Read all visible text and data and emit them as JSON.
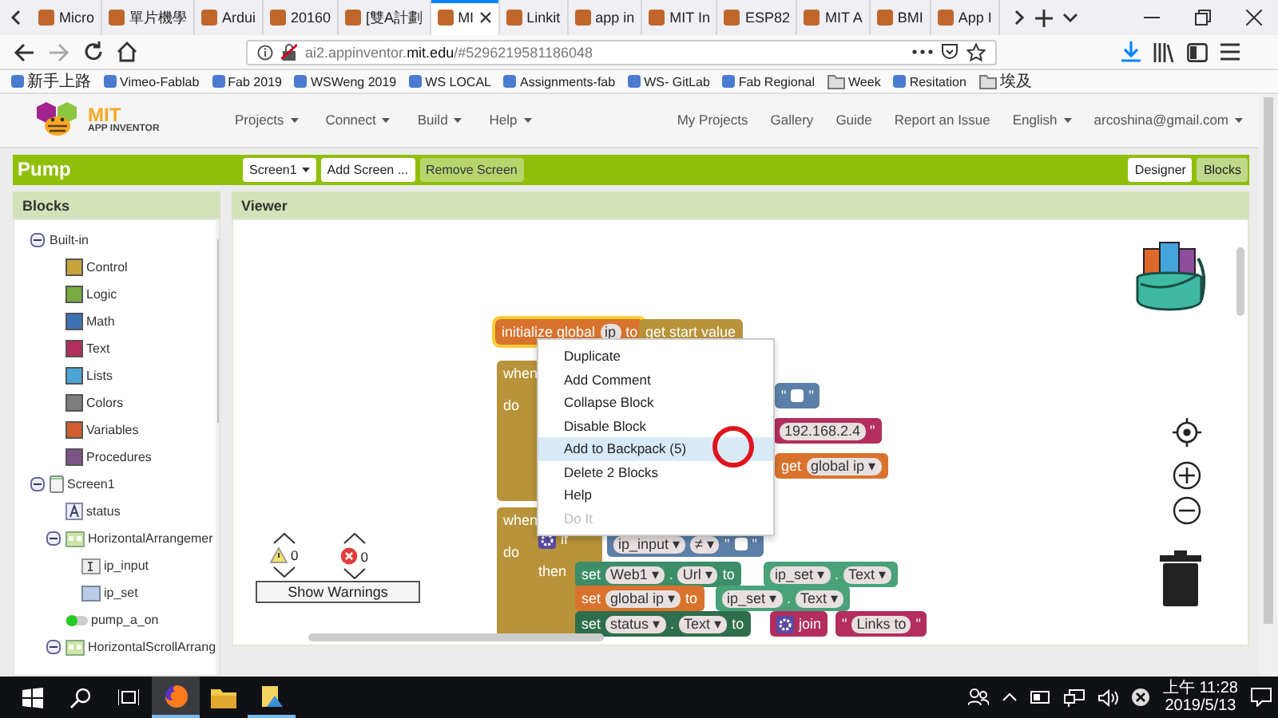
{
  "browser": {
    "tabs": [
      {
        "label": "Micro",
        "selected": false
      },
      {
        "label": "單片機學",
        "selected": false
      },
      {
        "label": "Ardui",
        "selected": false
      },
      {
        "label": "20160",
        "selected": false
      },
      {
        "label": "[雙A計劃",
        "selected": false
      },
      {
        "label": "MI",
        "selected": true
      },
      {
        "label": "Linkit",
        "selected": false
      },
      {
        "label": "app in",
        "selected": false
      },
      {
        "label": "MIT In",
        "selected": false
      },
      {
        "label": "ESP82",
        "selected": false
      },
      {
        "label": "MIT A",
        "selected": false
      },
      {
        "label": "BMI",
        "selected": false
      },
      {
        "label": "App I",
        "selected": false
      }
    ],
    "url": "ai2.appinventor.**mit.edu**/#5296219581186048",
    "bookmarks": [
      {
        "label": "新手上路",
        "kind": "site"
      },
      {
        "label": "Vimeo-Fablab",
        "kind": "site"
      },
      {
        "label": "Fab 2019",
        "kind": "site"
      },
      {
        "label": "WSWeng 2019",
        "kind": "site"
      },
      {
        "label": "WS LOCAL",
        "kind": "site"
      },
      {
        "label": "Assignments-fab",
        "kind": "site"
      },
      {
        "label": "WS- GitLab",
        "kind": "site"
      },
      {
        "label": "Fab Regional",
        "kind": "site"
      },
      {
        "label": "Week",
        "kind": "folder"
      },
      {
        "label": "Resitation",
        "kind": "site"
      },
      {
        "label": "埃及",
        "kind": "folder"
      }
    ]
  },
  "app": {
    "logo": {
      "title": "MIT",
      "subtitle": "APP INVENTOR"
    },
    "menus": [
      {
        "label": "Projects",
        "dropdown": true
      },
      {
        "label": "Connect",
        "dropdown": true
      },
      {
        "label": "Build",
        "dropdown": true
      },
      {
        "label": "Help",
        "dropdown": true
      }
    ],
    "links": [
      {
        "label": "My Projects",
        "dropdown": false
      },
      {
        "label": "Gallery",
        "dropdown": false
      },
      {
        "label": "Guide",
        "dropdown": false
      },
      {
        "label": "Report an Issue",
        "dropdown": false
      },
      {
        "label": "English",
        "dropdown": true
      },
      {
        "label": "arcoshina@gmail.com",
        "dropdown": true
      }
    ]
  },
  "project": {
    "name": "Pump",
    "screen": "Screen1",
    "buttons": [
      {
        "label": "Add Screen ...",
        "disabled": false
      },
      {
        "label": "Remove Screen",
        "disabled": true
      }
    ],
    "views": [
      {
        "label": "Designer",
        "selected": false
      },
      {
        "label": "Blocks",
        "selected": true
      }
    ]
  },
  "blocks_panel": {
    "title": "Blocks",
    "tree": [
      {
        "label": "Built-in",
        "kind": "group",
        "expanded": true,
        "children": [
          {
            "label": "Control",
            "kind": "category",
            "color": "#c9a43c"
          },
          {
            "label": "Logic",
            "kind": "category",
            "color": "#77ab41"
          },
          {
            "label": "Math",
            "kind": "category",
            "color": "#3f71b5"
          },
          {
            "label": "Text",
            "kind": "category",
            "color": "#b32d5e"
          },
          {
            "label": "Lists",
            "kind": "category",
            "color": "#49a6d4"
          },
          {
            "label": "Colors",
            "kind": "category",
            "color": "#7d7d7d"
          },
          {
            "label": "Variables",
            "kind": "category",
            "color": "#d05f2d"
          },
          {
            "label": "Procedures",
            "kind": "category",
            "color": "#7c5385"
          }
        ]
      },
      {
        "label": "Screen1",
        "kind": "screen",
        "expanded": true,
        "children": [
          {
            "label": "status",
            "kind": "label"
          },
          {
            "label": "HorizontalArrangemer",
            "kind": "arrangement",
            "expanded": true,
            "children": [
              {
                "label": "ip_input",
                "kind": "textbox"
              },
              {
                "label": "ip_set",
                "kind": "button"
              }
            ]
          },
          {
            "label": "pump_a_on",
            "kind": "switch"
          },
          {
            "label": "HorizontalScrollArrang",
            "kind": "arrangement",
            "expanded": true
          }
        ]
      }
    ]
  },
  "viewer": {
    "title": "Viewer",
    "blocks": [
      {
        "color": "#d9722c",
        "selected": true,
        "rows": [
          [
            {
              "kind": "label",
              "text": "initialize global"
            },
            {
              "kind": "field",
              "text": "ip"
            },
            {
              "kind": "label",
              "text": "to"
            }
          ]
        ]
      },
      {
        "color": "#b8933a",
        "selected": false,
        "rows": [
          [
            {
              "kind": "label",
              "text": "get start value"
            }
          ]
        ]
      },
      {
        "color": "#b8933a",
        "selected": false,
        "rows": [
          [
            {
              "kind": "label",
              "text": "when"
            }
          ],
          [
            {
              "kind": "label",
              "text": "do"
            }
          ]
        ]
      },
      {
        "color": "#5b7fa6",
        "selected": false,
        "rows": [
          [
            {
              "kind": "label",
              "text": "\""
            },
            {
              "kind": "blank"
            },
            {
              "kind": "label",
              "text": "\""
            }
          ]
        ]
      },
      {
        "color": "#b32d5e",
        "selected": false,
        "rows": [
          [
            {
              "kind": "field",
              "text": "192.168.2.4"
            },
            {
              "kind": "label",
              "text": "\""
            }
          ]
        ]
      },
      {
        "color": "#d9722c",
        "selected": false,
        "rows": [
          [
            {
              "kind": "label",
              "text": "get"
            },
            {
              "kind": "field",
              "text": "global ip ▾"
            }
          ]
        ]
      },
      {
        "color": "#b8933a",
        "selected": false,
        "rows": [
          [
            {
              "kind": "label",
              "text": "when"
            }
          ],
          [
            {
              "kind": "label",
              "text": "do"
            }
          ]
        ]
      },
      {
        "color": "#b8933a",
        "selected": false,
        "rows": [
          [
            {
              "kind": "gear"
            },
            {
              "kind": "label",
              "text": "if"
            }
          ],
          [
            {
              "kind": "label",
              "text": "then"
            }
          ]
        ]
      },
      {
        "color": "#5b7fa6",
        "selected": false,
        "rows": [
          [
            {
              "kind": "field",
              "text": "ip_input ▾"
            },
            {
              "kind": "field",
              "text": "≠ ▾"
            },
            {
              "kind": "label",
              "text": "\""
            },
            {
              "kind": "blank"
            },
            {
              "kind": "label",
              "text": "\""
            }
          ]
        ]
      },
      {
        "color": "#3d8d68",
        "selected": false,
        "rows": [
          [
            {
              "kind": "label",
              "text": "set"
            },
            {
              "kind": "field",
              "text": "Web1 ▾"
            },
            {
              "kind": "label",
              "text": "."
            },
            {
              "kind": "field",
              "text": "Url ▾"
            },
            {
              "kind": "label",
              "text": "to"
            }
          ]
        ]
      },
      {
        "color": "#4aa27a",
        "selected": false,
        "rows": [
          [
            {
              "kind": "field",
              "text": "ip_set ▾"
            },
            {
              "kind": "label",
              "text": "."
            },
            {
              "kind": "field",
              "text": "Text ▾"
            }
          ]
        ]
      },
      {
        "color": "#d9722c",
        "selected": false,
        "rows": [
          [
            {
              "kind": "label",
              "text": "set"
            },
            {
              "kind": "field",
              "text": "global ip ▾"
            },
            {
              "kind": "label",
              "text": "to"
            }
          ]
        ]
      },
      {
        "color": "#4aa27a",
        "selected": false,
        "rows": [
          [
            {
              "kind": "field",
              "text": "ip_set ▾"
            },
            {
              "kind": "label",
              "text": "."
            },
            {
              "kind": "field",
              "text": "Text ▾"
            }
          ]
        ]
      },
      {
        "color": "#2f6e4c",
        "selected": false,
        "rows": [
          [
            {
              "kind": "label",
              "text": "set"
            },
            {
              "kind": "field",
              "text": "status ▾"
            },
            {
              "kind": "label",
              "text": "."
            },
            {
              "kind": "field",
              "text": "Text ▾"
            },
            {
              "kind": "label",
              "text": "to"
            }
          ]
        ]
      },
      {
        "color": "#b32d5e",
        "selected": false,
        "rows": [
          [
            {
              "kind": "gear"
            },
            {
              "kind": "label",
              "text": "join"
            }
          ]
        ]
      },
      {
        "color": "#b32d5e",
        "selected": false,
        "rows": [
          [
            {
              "kind": "label",
              "text": "\""
            },
            {
              "kind": "field",
              "text": "Links to"
            },
            {
              "kind": "label",
              "text": "\""
            }
          ]
        ]
      }
    ],
    "context_menu": [
      {
        "label": "Duplicate",
        "selected": false,
        "disabled": false
      },
      {
        "label": "Add Comment",
        "selected": false,
        "disabled": false
      },
      {
        "label": "Collapse Block",
        "selected": false,
        "disabled": false
      },
      {
        "label": "Disable Block",
        "selected": false,
        "disabled": false
      },
      {
        "label": "Add to Backpack (5)",
        "selected": true,
        "disabled": false
      },
      {
        "label": "Delete 2 Blocks",
        "selected": false,
        "disabled": false
      },
      {
        "label": "Help",
        "selected": false,
        "disabled": false
      },
      {
        "label": "Do It",
        "selected": false,
        "disabled": true
      }
    ],
    "warnings": [
      {
        "kind": "warning",
        "count": "0"
      },
      {
        "kind": "error",
        "count": "0"
      }
    ],
    "show_warnings": "Show Warnings"
  },
  "taskbar": {
    "apps": [
      {
        "kind": "browser",
        "active": true,
        "running": true
      },
      {
        "kind": "folder",
        "active": false,
        "running": false
      },
      {
        "kind": "app",
        "active": false,
        "running": true
      }
    ],
    "time": "上午 11:28",
    "date": "2019/5/13"
  }
}
